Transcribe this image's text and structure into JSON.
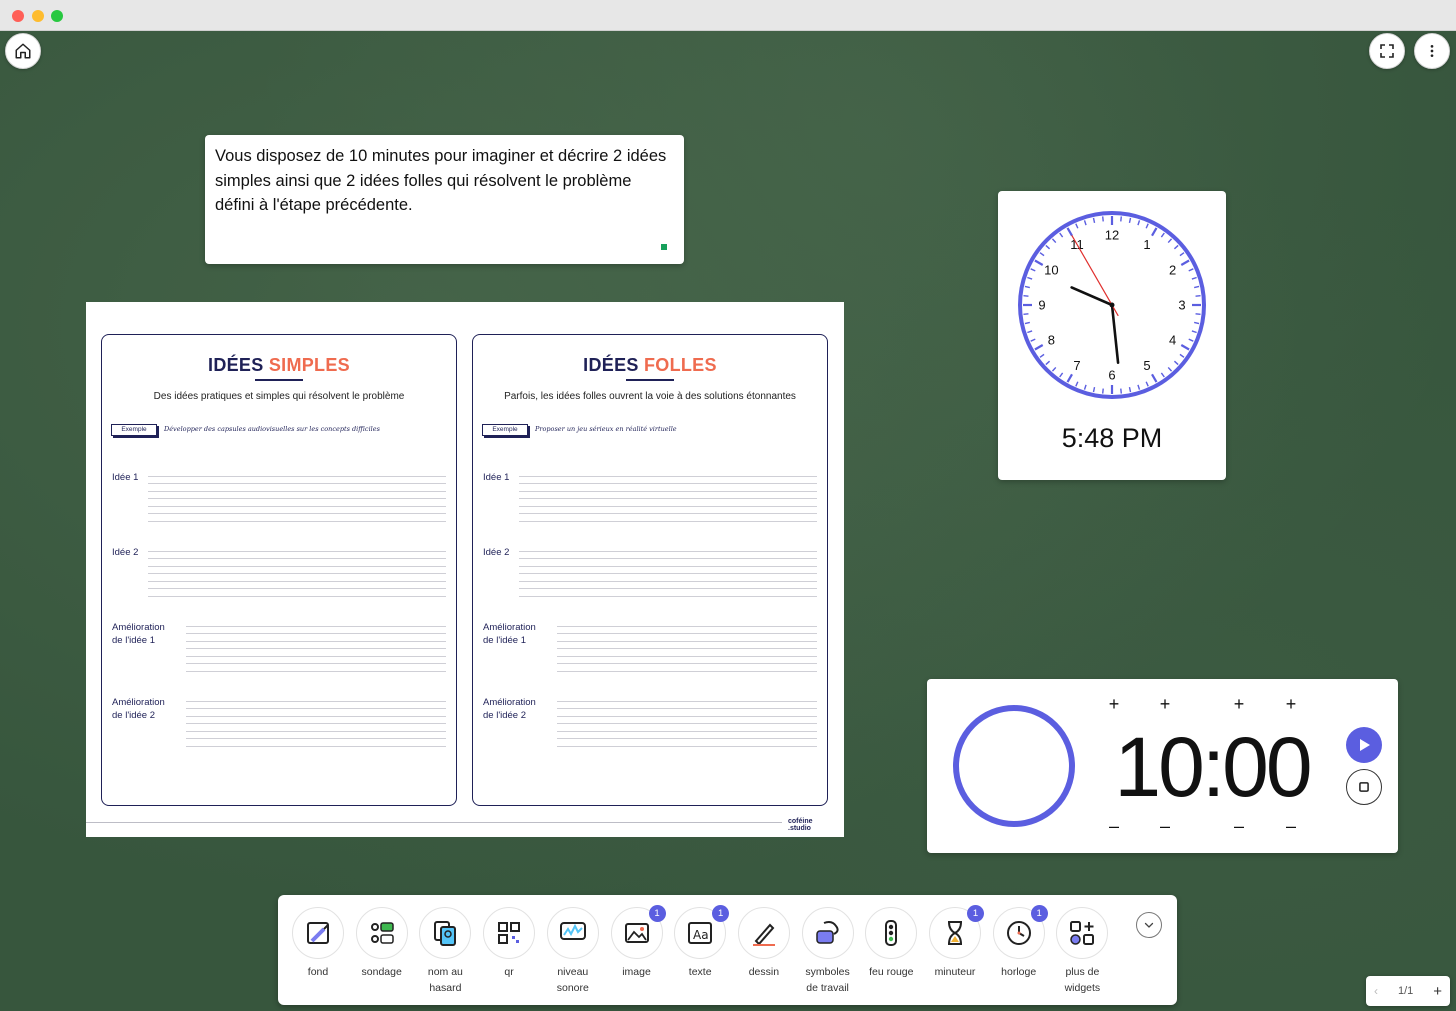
{
  "note": {
    "text": "Vous disposez de 10 minutes pour imaginer et décrire 2 idées simples ainsi que 2 idées folles qui résolvent le problème défini à l'étape précédente."
  },
  "worksheet": {
    "panels": [
      {
        "title_main": "IDÉES ",
        "title_accent": "SIMPLES",
        "subtitle": "Des idées pratiques et simples qui résolvent le problème",
        "example_label": "Exemple",
        "example_text": "Développer des capsules audiovisuelles sur les concepts difficiles",
        "labels": [
          "Idée 1",
          "Idée 2",
          "Amélioration\nde l'idée 1",
          "Amélioration\nde l'idée 2"
        ]
      },
      {
        "title_main": "IDÉES ",
        "title_accent": "FOLLES",
        "subtitle": "Parfois, les idées folles ouvrent la voie à des solutions étonnantes",
        "example_label": "Exemple",
        "example_text": "Proposer un jeu sérieux en réalité virtuelle",
        "labels": [
          "Idée 1",
          "Idée 2",
          "Amélioration\nde l'idée 1",
          "Amélioration\nde l'idée 2"
        ]
      }
    ],
    "logo_line1": "coféine",
    "logo_line2": ".studio"
  },
  "clock": {
    "hours": 5,
    "minutes": 48,
    "seconds": 55,
    "digital": "5:48 PM",
    "numbers": [
      "12",
      "1",
      "2",
      "3",
      "4",
      "5",
      "6",
      "7",
      "8",
      "9",
      "10",
      "11"
    ],
    "accent": "#5b5ee0",
    "second_hand_color": "#e0302e"
  },
  "timer": {
    "display": "10:00",
    "plus": "+",
    "minus": "–",
    "accent": "#5b5ee0"
  },
  "toolbar": {
    "tools": [
      {
        "label": "fond",
        "icon": "background-icon",
        "badge": ""
      },
      {
        "label": "sondage",
        "icon": "poll-icon",
        "badge": ""
      },
      {
        "label": "nom au\nhasard",
        "icon": "random-name-icon",
        "badge": ""
      },
      {
        "label": "qr",
        "icon": "qr-code-icon",
        "badge": ""
      },
      {
        "label": "niveau\nsonore",
        "icon": "sound-level-icon",
        "badge": ""
      },
      {
        "label": "image",
        "icon": "image-icon",
        "badge": "1"
      },
      {
        "label": "texte",
        "icon": "text-icon",
        "badge": "1"
      },
      {
        "label": "dessin",
        "icon": "drawing-icon",
        "badge": ""
      },
      {
        "label": "symboles\nde travail",
        "icon": "work-symbols-icon",
        "badge": ""
      },
      {
        "label": "feu rouge",
        "icon": "traffic-light-icon",
        "badge": ""
      },
      {
        "label": "minuteur",
        "icon": "hourglass-icon",
        "badge": "1"
      },
      {
        "label": "horloge",
        "icon": "clock-icon",
        "badge": "1"
      },
      {
        "label": "plus de\nwidgets",
        "icon": "more-widgets-icon",
        "badge": ""
      }
    ]
  },
  "pager": {
    "count": "1/1",
    "prev": "‹",
    "add": "+"
  }
}
